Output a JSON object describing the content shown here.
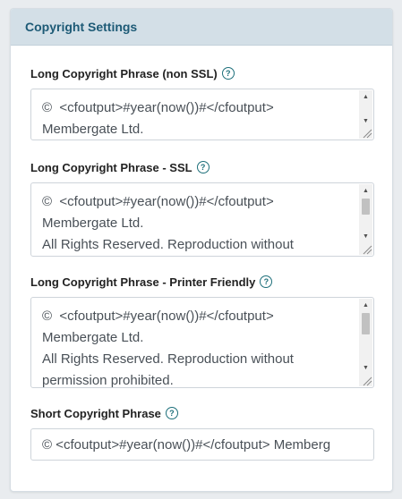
{
  "panel": {
    "title": "Copyright Settings"
  },
  "fields": [
    {
      "label": "Long Copyright Phrase (non SSL)",
      "value": "©  <cfoutput>#year(now())#</cfoutput>\nMembergate Ltd."
    },
    {
      "label": "Long Copyright Phrase - SSL",
      "value": "©  <cfoutput>#year(now())#</cfoutput>\nMembergate Ltd.\nAll Rights Reserved. Reproduction without"
    },
    {
      "label": "Long Copyright Phrase - Printer Friendly",
      "value": "©  <cfoutput>#year(now())#</cfoutput>\nMembergate Ltd.\nAll Rights Reserved. Reproduction without\npermission prohibited."
    },
    {
      "label": "Short Copyright Phrase",
      "value": "©  <cfoutput>#year(now())#</cfoutput> Memberg"
    }
  ],
  "help_icon_glyph": "?"
}
